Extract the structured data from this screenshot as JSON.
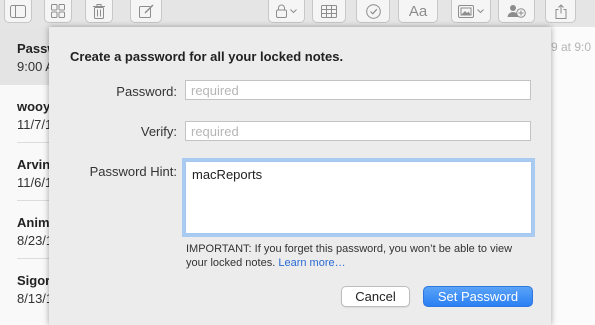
{
  "toolbar": {
    "icons": [
      "sidebar-icon",
      "gallery-icon",
      "trash-icon",
      "compose-icon",
      "lock-icon",
      "table-icon",
      "checklist-icon",
      "format-text-icon",
      "media-icon",
      "collaborate-icon",
      "share-icon"
    ]
  },
  "notes_list": {
    "items": [
      {
        "title": "Passw",
        "date": "9:00 A"
      },
      {
        "title": "wooy",
        "date": "11/7/1"
      },
      {
        "title": "Arvin",
        "date": "11/6/1"
      },
      {
        "title": "Anim",
        "date": "8/23/1"
      },
      {
        "title": "Sigor",
        "date": "8/13/1"
      }
    ]
  },
  "background": {
    "note_time": "9 at 9:0"
  },
  "dialog": {
    "title": "Create a password for all your locked notes.",
    "password_label": "Password:",
    "password_placeholder": "required",
    "verify_label": "Verify:",
    "verify_placeholder": "required",
    "hint_label": "Password Hint:",
    "hint_value": "macReports",
    "important_text": "IMPORTANT: If you forget this password, you won’t be able to view your locked notes.",
    "learn_more": "Learn more…",
    "cancel_label": "Cancel",
    "set_password_label": "Set Password"
  },
  "colors": {
    "accent": "#2a7ff3",
    "link": "#2a6bd5",
    "focus_ring": "#a9cbf2"
  }
}
